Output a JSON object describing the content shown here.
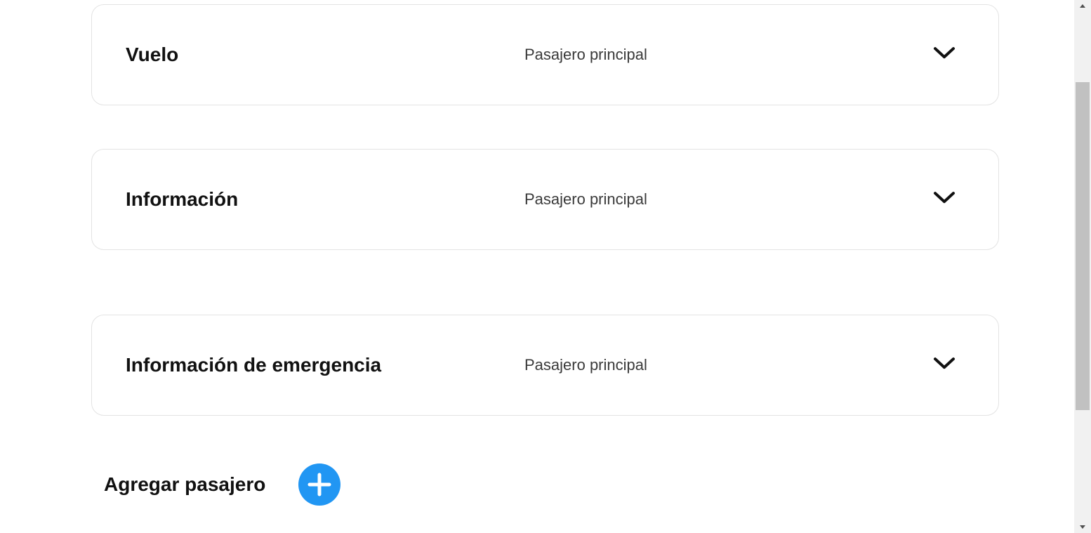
{
  "sections": [
    {
      "title": "Vuelo",
      "subtitle": "Pasajero principal",
      "icon": "chevron-down-icon"
    },
    {
      "title": "Información",
      "subtitle": "Pasajero principal",
      "icon": "chevron-down-icon"
    },
    {
      "title": "Información de emergencia",
      "subtitle": "Pasajero principal",
      "icon": "chevron-down-icon"
    }
  ],
  "add_passenger": {
    "label": "Agregar pasajero",
    "icon": "plus-icon",
    "color": "#2196f3"
  },
  "scrollbar": {
    "up_icon": "scroll-up-arrow-icon",
    "down_icon": "scroll-down-arrow-icon"
  }
}
